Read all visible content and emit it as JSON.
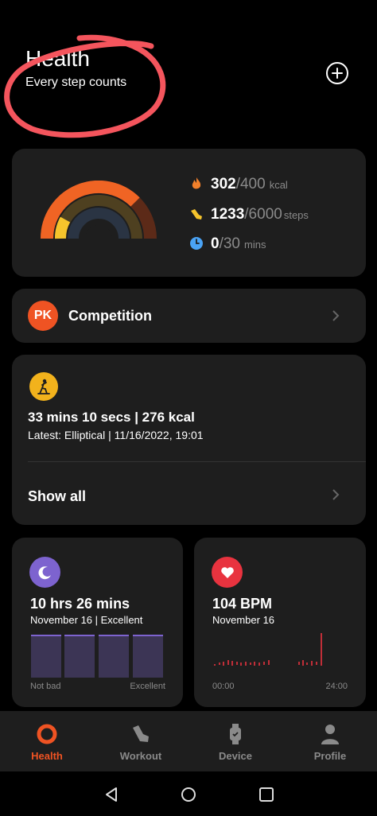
{
  "header": {
    "title": "Health",
    "subtitle": "Every step counts",
    "add_icon": "plus-circle-icon"
  },
  "activity": {
    "calories": {
      "current": "302",
      "goal": "/400",
      "unit": "kcal",
      "icon": "flame-icon",
      "color": "#f2802b"
    },
    "steps": {
      "current": "1233",
      "goal": "/6000",
      "unit": "steps",
      "icon": "shoe-icon",
      "color": "#f5c42c"
    },
    "mins": {
      "current": "0",
      "goal": "/30",
      "unit": "mins",
      "icon": "clock-icon",
      "color": "#4aa3f5"
    },
    "progress": {
      "calories": 0.755,
      "steps": 0.2055,
      "mins": 0.0
    }
  },
  "competition": {
    "badge": "PK",
    "label": "Competition"
  },
  "workout": {
    "icon": "elliptical-icon",
    "summary": "33 mins 10 secs | 276 kcal",
    "latest": "Latest: Elliptical | 11/16/2022, 19:01",
    "show_all": "Show all"
  },
  "sleep": {
    "icon": "moon-icon",
    "duration": "10 hrs 26 mins",
    "detail": "November 16 | Excellent",
    "axis_left": "Not bad",
    "axis_right": "Excellent"
  },
  "heart": {
    "icon": "heart-icon",
    "bpm": "104 BPM",
    "date": "November 16",
    "axis_left": "00:00",
    "axis_right": "24:00"
  },
  "tabs": [
    {
      "label": "Health",
      "icon": "health-ring-icon",
      "active": true
    },
    {
      "label": "Workout",
      "icon": "shoe-icon",
      "active": false
    },
    {
      "label": "Device",
      "icon": "watch-icon",
      "active": false
    },
    {
      "label": "Profile",
      "icon": "person-icon",
      "active": false
    }
  ],
  "colors": {
    "accent": "#ef5323",
    "card": "#1e1e1e",
    "muted": "#8a8a8a",
    "sleep": "#7d63cf",
    "heart": "#e8333f"
  }
}
